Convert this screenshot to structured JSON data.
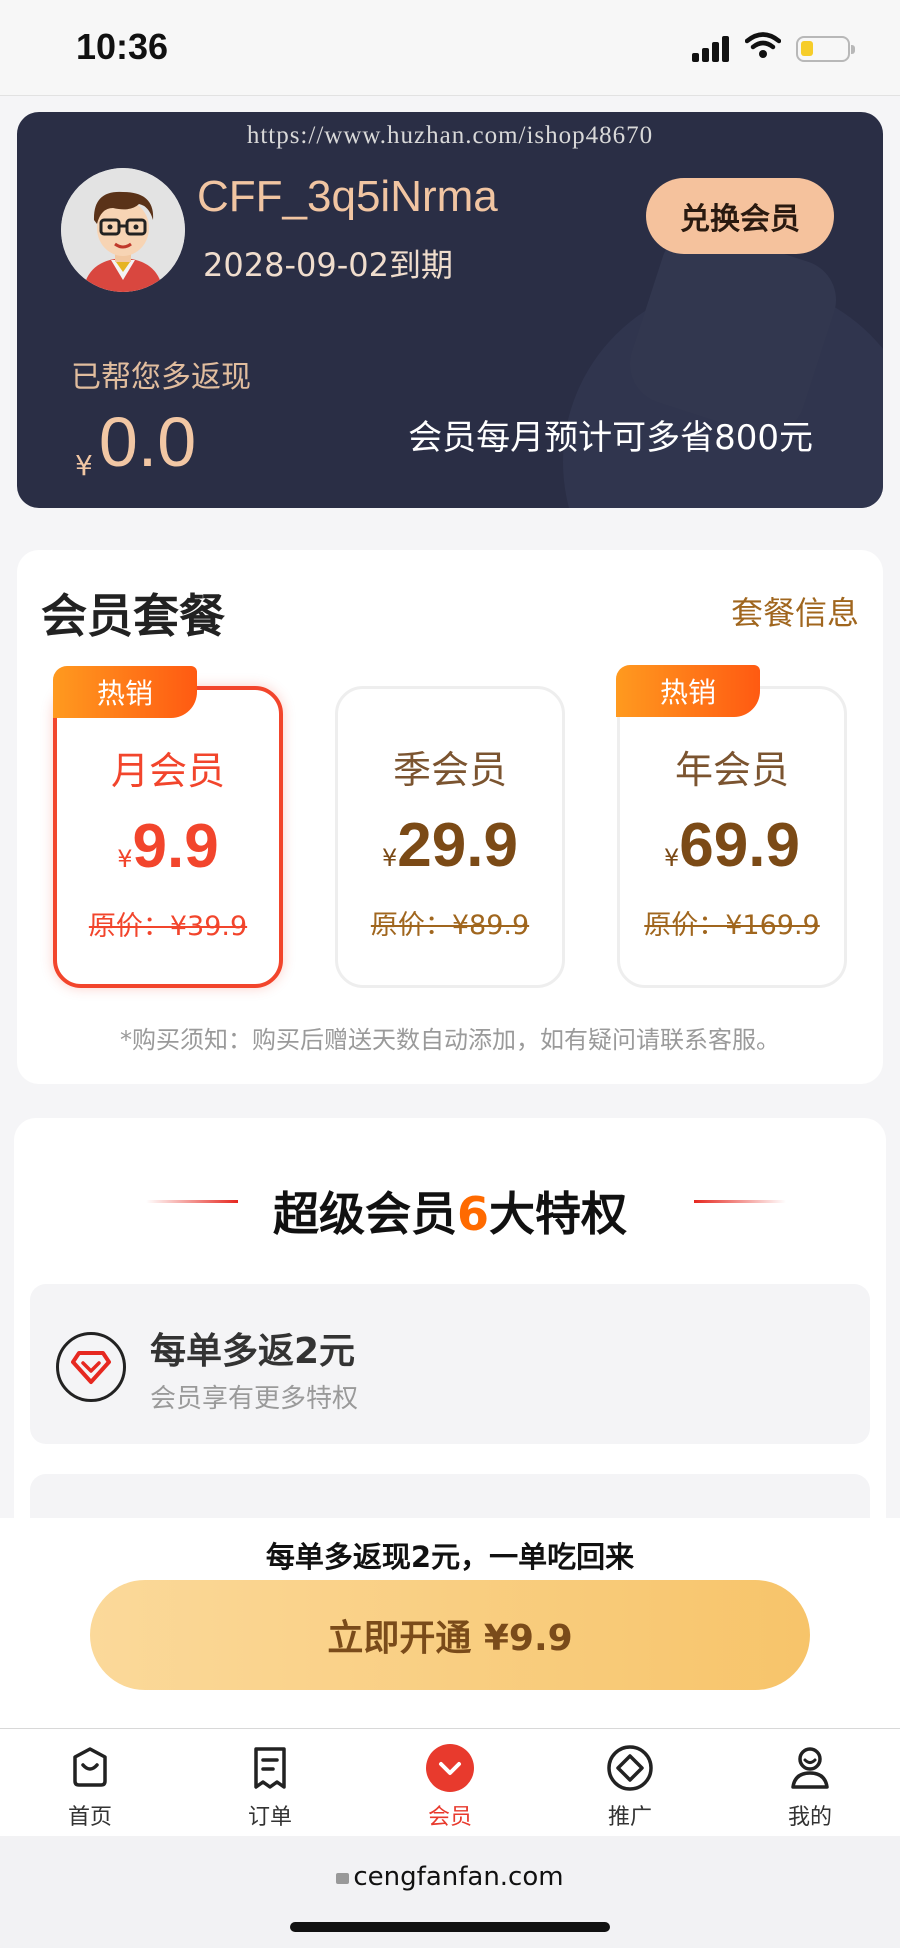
{
  "status_bar": {
    "time": "10:36"
  },
  "member_card": {
    "watermark": "https://www.huzhan.com/ishop48670",
    "username": "CFF_3q5iNrma",
    "expiry": "2028-09-02到期",
    "redeem_label": "兑换会员",
    "cashback_label": "已帮您多返现",
    "currency": "¥",
    "cashback_value": "0.0",
    "save_note": "会员每月预计可多省800元"
  },
  "plans": {
    "title": "会员套餐",
    "info_link": "套餐信息",
    "items": [
      {
        "hot": "热销",
        "name": "月会员",
        "currency": "¥",
        "price": "9.9",
        "original": "原价：¥39.9"
      },
      {
        "hot": "",
        "name": "季会员",
        "currency": "¥",
        "price": "29.9",
        "original": "原价：¥89.9"
      },
      {
        "hot": "热销",
        "name": "年会员",
        "currency": "¥",
        "price": "69.9",
        "original": "原价：¥169.9"
      }
    ],
    "note": "*购买须知：购买后赠送天数自动添加，如有疑问请联系客服。"
  },
  "perks": {
    "title_prefix": "超级会员",
    "title_number": "6",
    "title_suffix": "大特权",
    "items": [
      {
        "title": "每单多返2元",
        "subtitle": "会员享有更多特权",
        "icon": "diamond-icon"
      }
    ]
  },
  "cta": {
    "tip": "每单多返现2元，一单吃回来",
    "button": "立即开通 ¥9.9"
  },
  "tabbar": {
    "items": [
      {
        "label": "首页",
        "icon": "home-icon"
      },
      {
        "label": "订单",
        "icon": "order-icon"
      },
      {
        "label": "会员",
        "icon": "member-icon"
      },
      {
        "label": "推广",
        "icon": "promote-icon"
      },
      {
        "label": "我的",
        "icon": "profile-icon"
      }
    ],
    "active_color": "#e83a2d"
  },
  "browser": {
    "url": "cengfanfan.com"
  },
  "colors": {
    "card_bg": "#2a2e45",
    "accent": "#f2452c",
    "gold": "#a0661e",
    "cta": "#f7c46a"
  }
}
